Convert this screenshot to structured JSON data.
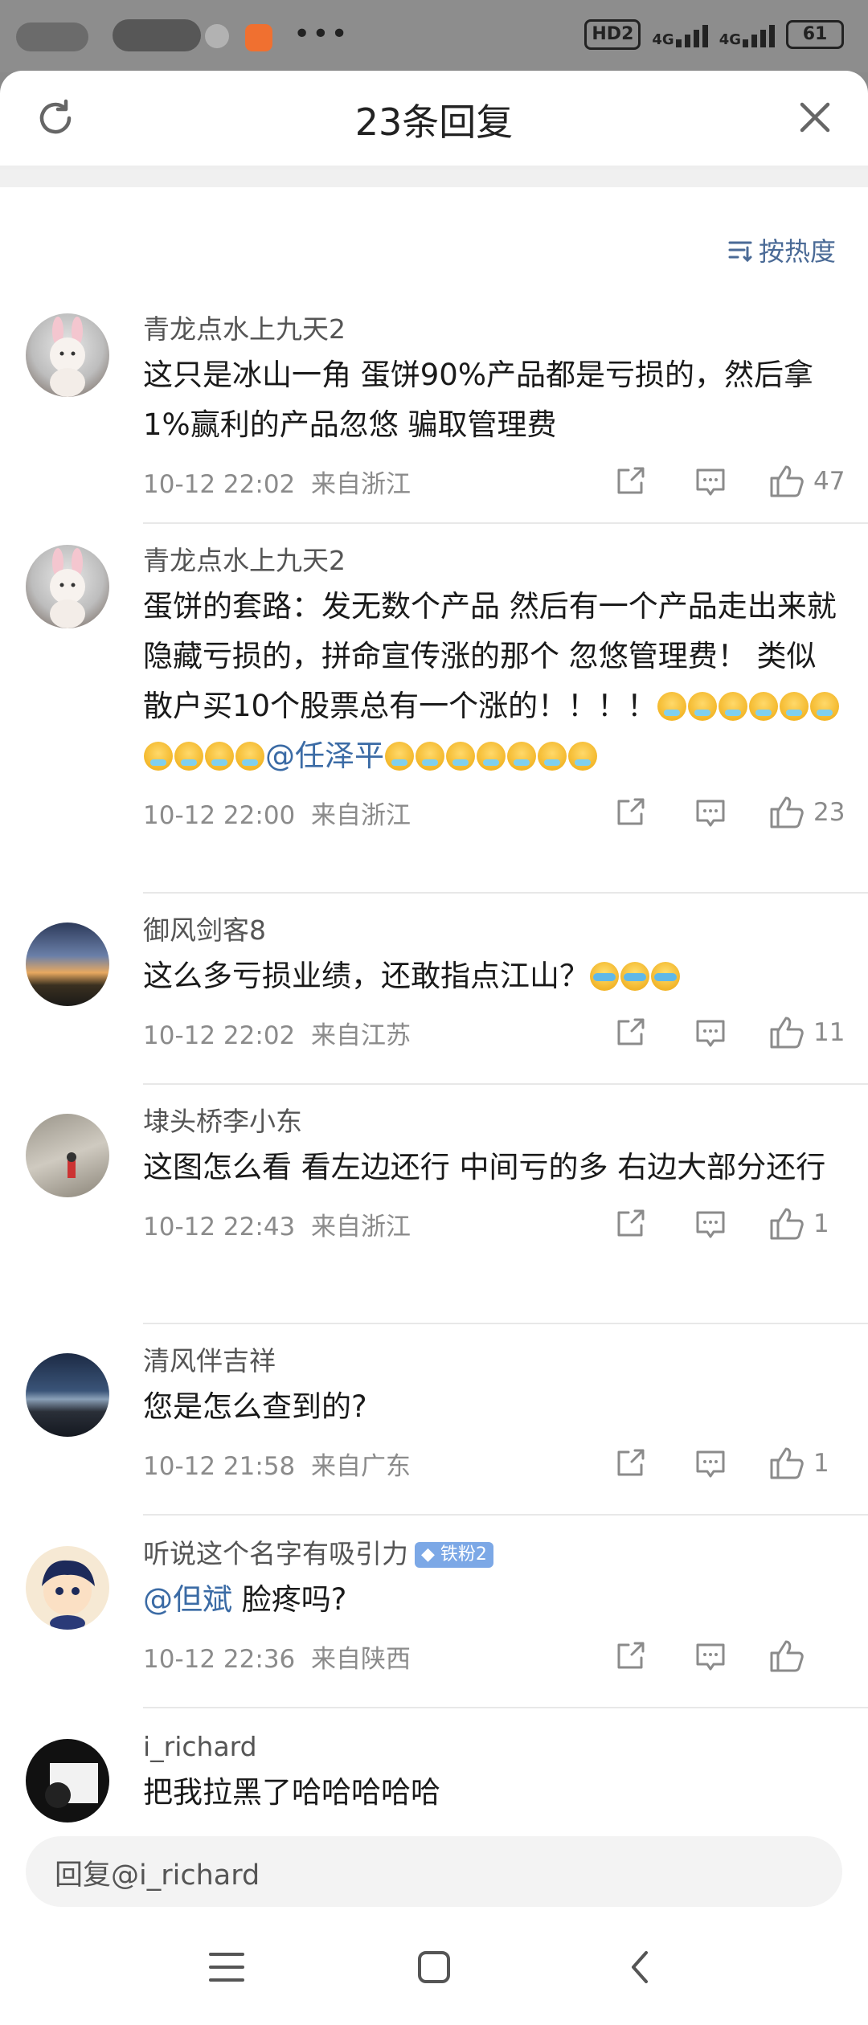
{
  "status_bar": {
    "hd": "HD2",
    "net1": "4G",
    "net2": "4G",
    "battery": "61",
    "dots": "•••"
  },
  "header": {
    "title": "23条回复"
  },
  "sort_label": "按热度",
  "comments": [
    {
      "user": "青龙点水上九天2",
      "text": "这只是冰山一角 蛋饼90%产品都是亏损的，然后拿1%赢利的产品忽悠 骗取管理费",
      "time": "10-12 22:02",
      "location": "来自浙江",
      "likes": "47"
    },
    {
      "user": "青龙点水上九天2",
      "text_pre": "蛋饼的套路：发无数个产品  然后有一个产品走出来就隐藏亏损的，拼命宣传涨的那个  忽悠管理费！ 类似散户买10个股票总有一个涨的！！！！",
      "mention": "@任泽平",
      "time": "10-12 22:00",
      "location": "来自浙江",
      "likes": "23"
    },
    {
      "user": "御风剑客8",
      "text": "这么多亏损业绩，还敢指点江山？",
      "time": "10-12 22:02",
      "location": "来自江苏",
      "likes": "11"
    },
    {
      "user": "埭头桥李小东",
      "text": "这图怎么看    看左边还行  中间亏的多  右边大部分还行",
      "time": "10-12 22:43",
      "location": "来自浙江",
      "likes": "1"
    },
    {
      "user": "清风伴吉祥",
      "text": "您是怎么查到的?",
      "time": "10-12 21:58",
      "location": "来自广东",
      "likes": "1"
    },
    {
      "user": "听说这个名字有吸引力",
      "badge": "铁粉2",
      "mention": "@但斌",
      "text": " 脸疼吗?",
      "time": "10-12 22:36",
      "location": "来自陕西",
      "likes": ""
    },
    {
      "user": "i_richard",
      "text": "把我拉黑了哈哈哈哈哈"
    }
  ],
  "reply_input": {
    "placeholder": "回复@i_richard"
  },
  "colors": {
    "accent": "#3b6ba5",
    "meta": "#8b8b8b"
  }
}
